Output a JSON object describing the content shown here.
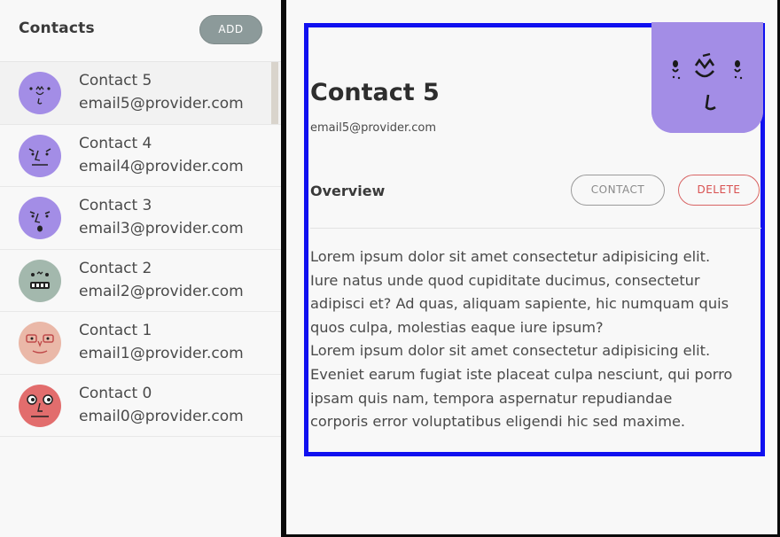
{
  "sidebar": {
    "title": "Contacts",
    "add_label": "ADD",
    "contacts": [
      {
        "name": "Contact 5",
        "email": "email5@provider.com",
        "avatar_color": "#a38de6",
        "selected": true
      },
      {
        "name": "Contact 4",
        "email": "email4@provider.com",
        "avatar_color": "#a38de6",
        "selected": false
      },
      {
        "name": "Contact 3",
        "email": "email3@provider.com",
        "avatar_color": "#a38de6",
        "selected": false
      },
      {
        "name": "Contact 2",
        "email": "email2@provider.com",
        "avatar_color": "#a3b8ad",
        "selected": false
      },
      {
        "name": "Contact 1",
        "email": "email1@provider.com",
        "avatar_color": "#eab8a8",
        "selected": false
      },
      {
        "name": "Contact 0",
        "email": "email0@provider.com",
        "avatar_color": "#e26d6d",
        "selected": false
      }
    ]
  },
  "detail": {
    "name": "Contact 5",
    "email": "email5@provider.com",
    "overview_label": "Overview",
    "contact_label": "CONTACT",
    "delete_label": "DELETE",
    "avatar_color": "#a38de6",
    "description_lines": [
      "Lorem ipsum dolor sit amet consectetur adipisicing elit.",
      "Iure natus unde quod cupiditate ducimus, consectetur",
      "adipisci et? Ad quas, aliquam sapiente, hic numquam quis",
      "quos culpa, molestias eaque iure ipsum?",
      "Lorem ipsum dolor sit amet consectetur adipisicing elit.",
      "Eveniet earum fugiat iste placeat culpa nesciunt, qui porro",
      "ipsam quis nam, tempora aspernatur repudiandae",
      "corporis error voluptatibus eligendi hic sed maxime."
    ]
  },
  "colors": {
    "selection_border": "#1010f0",
    "delete_accent": "#d85050",
    "add_button_bg": "#8c9a9a"
  }
}
